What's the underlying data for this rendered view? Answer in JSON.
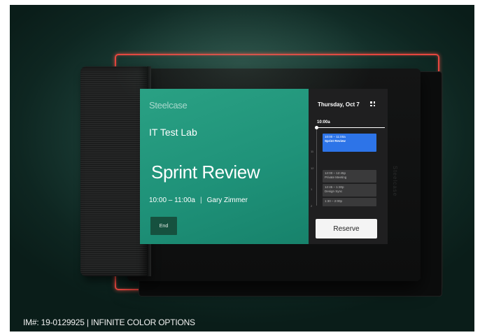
{
  "colors": {
    "accent_green": "#1f9279",
    "current_event_blue": "#2d74e8",
    "frame_red": "#e5473f"
  },
  "main": {
    "brand": "Steelcase",
    "room_name": "IT Test Lab",
    "meeting_title": "Sprint Review",
    "time_range": "10:00 – 11:00a",
    "separator": "|",
    "organizer": "Gary Zimmer",
    "end_label": "End"
  },
  "side": {
    "date": "Thursday, Oct 7",
    "grid_icon": "grid-icon",
    "now_time": "10:00a",
    "hour_ticks": [
      "11",
      "12",
      "1",
      "2"
    ],
    "events": [
      {
        "time": "10:00 – 11:00a",
        "title": "Sprint Review"
      },
      {
        "time": "12:00 – 12:45p",
        "title": "Private Meeting"
      },
      {
        "time": "12:45 – 1:30p",
        "title": "Design Sync"
      },
      {
        "time": "1:30 – 2:00p",
        "title": ""
      }
    ],
    "reserve_label": "Reserve"
  },
  "caption": "IM#: 19-0129925 | INFINITE COLOR OPTIONS"
}
